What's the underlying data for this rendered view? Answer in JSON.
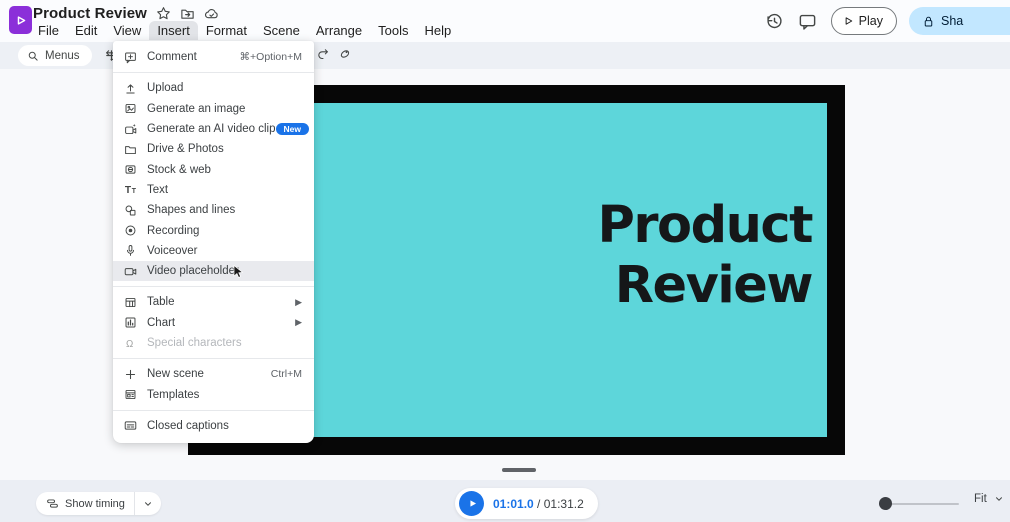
{
  "header": {
    "title": "Product Review",
    "menu_items": [
      "File",
      "Edit",
      "View",
      "Insert",
      "Format",
      "Scene",
      "Arrange",
      "Tools",
      "Help"
    ],
    "active_menu": "Insert",
    "play_label": "Play",
    "share_label": "Sha"
  },
  "toolbar": {
    "menus_label": "Menus"
  },
  "insert_menu": {
    "sections": [
      {
        "items": [
          {
            "label": "Comment",
            "icon": "comment-add",
            "shortcut": "⌘+Option+M"
          }
        ]
      },
      {
        "items": [
          {
            "label": "Upload",
            "icon": "upload"
          },
          {
            "label": "Generate an image",
            "icon": "gen-image"
          },
          {
            "label": "Generate an AI video clip",
            "icon": "ai-video",
            "badge": "New"
          },
          {
            "label": "Drive & Photos",
            "icon": "folder"
          },
          {
            "label": "Stock & web",
            "icon": "stock-web"
          },
          {
            "label": "Text",
            "icon": "text"
          },
          {
            "label": "Shapes and lines",
            "icon": "shapes"
          },
          {
            "label": "Recording",
            "icon": "recording"
          },
          {
            "label": "Voiceover",
            "icon": "mic"
          },
          {
            "label": "Video placeholder",
            "icon": "video",
            "highlighted": true
          }
        ]
      },
      {
        "items": [
          {
            "label": "Table",
            "icon": "table",
            "submenu": true
          },
          {
            "label": "Chart",
            "icon": "chart",
            "submenu": true
          },
          {
            "label": "Special characters",
            "icon": "omega",
            "disabled": true
          }
        ]
      },
      {
        "items": [
          {
            "label": "New scene",
            "icon": "plus",
            "shortcut": "Ctrl+M"
          },
          {
            "label": "Templates",
            "icon": "templates"
          }
        ]
      },
      {
        "items": [
          {
            "label": "Closed captions",
            "icon": "captions"
          }
        ]
      }
    ]
  },
  "canvas": {
    "title_line1": "Product",
    "title_line2": "Review",
    "slide_background": "#5dd6da"
  },
  "player": {
    "current_time": "01:01.0",
    "separator": " / ",
    "total_time": "01:31.2"
  },
  "bottom": {
    "show_timing_label": "Show timing",
    "fit_label": "Fit"
  },
  "colors": {
    "accent_blue": "#1a73e8",
    "logo_purple": "#8b2fd9",
    "share_pill_bg": "#c2e7ff",
    "slide_teal": "#5dd6da",
    "canvas_frame": "#070707"
  }
}
